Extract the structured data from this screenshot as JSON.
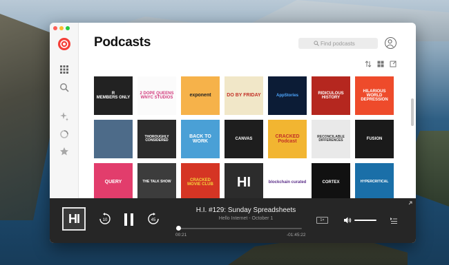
{
  "app": {
    "title": "Podcasts"
  },
  "search": {
    "placeholder": "Find podcasts"
  },
  "sidebar": {
    "items": [
      {
        "name": "sidebar-item-discover",
        "icon": "grid-icon"
      },
      {
        "name": "sidebar-item-search",
        "icon": "search-icon"
      },
      {
        "name": "sidebar-item-new",
        "icon": "sparkle-icon"
      },
      {
        "name": "sidebar-item-in-progress",
        "icon": "progress-ring-icon"
      },
      {
        "name": "sidebar-item-starred",
        "icon": "star-icon"
      }
    ]
  },
  "toolbar": {
    "icons": [
      "sort-icon",
      "grid-view-icon",
      "export-icon"
    ]
  },
  "podcasts": [
    {
      "label": "R\nMEMBERS ONLY",
      "bg": "#222222",
      "fg": "#ffffff",
      "size": 6
    },
    {
      "label": "2 DOPE QUEENS\nWNYC STUDIOS",
      "bg": "#fbfbfb",
      "fg": "#d23a7c",
      "size": 6
    },
    {
      "label": "exponent",
      "bg": "#f6b24a",
      "fg": "#222222",
      "size": 7
    },
    {
      "label": "DO BY FRIDAY",
      "bg": "#f1e7c8",
      "fg": "#c23127",
      "size": 7
    },
    {
      "label": "AppStories",
      "bg": "#0c1c36",
      "fg": "#4ea7ff",
      "size": 6
    },
    {
      "label": "RIDICULOUS\nHISTORY",
      "bg": "#b5271f",
      "fg": "#ffffff",
      "size": 6
    },
    {
      "label": "HILARIOUS\nWORLD\nDEPRESSION",
      "bg": "#ee4b2b",
      "fg": "#ffffff",
      "size": 6
    },
    {
      "label": "",
      "bg": "#4d6b89",
      "fg": "#ffffff",
      "size": 6
    },
    {
      "label": "THOROUGHLY\nCONSIDERED",
      "bg": "#2b2b2b",
      "fg": "#ffffff",
      "size": 5
    },
    {
      "label": "BACK TO\nWORK",
      "bg": "#4aa0d6",
      "fg": "#ffffff",
      "size": 7
    },
    {
      "label": "CANVAS",
      "bg": "#1e1e1e",
      "fg": "#ffffff",
      "size": 6
    },
    {
      "label": "CRACKED\nPodcast",
      "bg": "#f2b531",
      "fg": "#c23127",
      "size": 7
    },
    {
      "label": "RECONCILABLE\nDIFFERENCES",
      "bg": "#e9e9e9",
      "fg": "#333333",
      "size": 5
    },
    {
      "label": "FUSION",
      "bg": "#1a1a1a",
      "fg": "#ffffff",
      "size": 6
    },
    {
      "label": "QUERY",
      "bg": "#e23d6c",
      "fg": "#ffffff",
      "size": 7
    },
    {
      "label": "THE TALK SHOW",
      "bg": "#3c3c3c",
      "fg": "#ffffff",
      "size": 5
    },
    {
      "label": "CRACKED\nMOVIE CLUB",
      "bg": "#d53524",
      "fg": "#f5d53b",
      "size": 6
    },
    {
      "label": "HI",
      "bg": "#2c2c2c",
      "fg": "#ffffff",
      "size": 20
    },
    {
      "label": "blockchain curated",
      "bg": "#ffffff",
      "fg": "#5a2d88",
      "size": 6
    },
    {
      "label": "CORTEX",
      "bg": "#111111",
      "fg": "#ffffff",
      "size": 6
    },
    {
      "label": "HYPERCRITICAL",
      "bg": "#1a6fa8",
      "fg": "#ffffff",
      "size": 5
    }
  ],
  "player": {
    "artwork_label": "HI",
    "episode_title": "H.I. #129: Sunday Spreadsheets",
    "episode_subtitle": "Hello Internet - October 1",
    "elapsed": "00:21",
    "remaining": "-01:45:22",
    "progress": 0.005,
    "skip_back_label": "10",
    "skip_forward_label": "45",
    "speed_label": "1×",
    "volume": 1.0
  }
}
